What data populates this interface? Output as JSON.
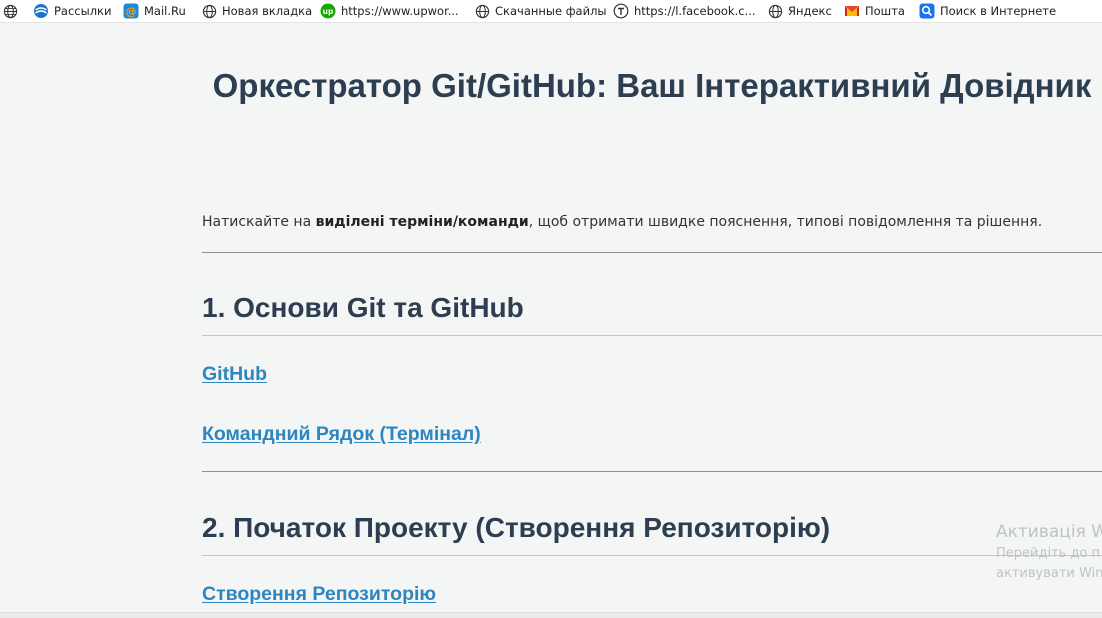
{
  "bookmarks": [
    {
      "label": "",
      "icon": "globe-icon"
    },
    {
      "label": "Рассылки",
      "icon": "mailing-icon"
    },
    {
      "label": "Mail.Ru",
      "icon": "mailru-icon"
    },
    {
      "label": "Новая вкладка",
      "icon": "globe-icon"
    },
    {
      "label": "https://www.upwor...",
      "icon": "upwork-icon"
    },
    {
      "label": "Скачанные файлы",
      "icon": "globe-icon"
    },
    {
      "label": "https://l.facebook.c...",
      "icon": "tumblr-like-icon"
    },
    {
      "label": "Яндекс",
      "icon": "globe-icon"
    },
    {
      "label": "Пошта",
      "icon": "gmail-icon"
    },
    {
      "label": "Поиск в Интернете",
      "icon": "search-icon"
    }
  ],
  "page": {
    "title": "Оркестратор Git/GitHub: Ваш Інтерактивний Довідник",
    "intro_prefix": "Натискайте на ",
    "intro_bold": "виділені терміни/команди",
    "intro_suffix": ", щоб отримати швидке пояснення, типові повідомлення та рішення."
  },
  "sections": [
    {
      "title": "1. Основи Git та GitHub",
      "terms": [
        "GitHub",
        "Командний Рядок (Термінал)"
      ]
    },
    {
      "title": "2. Початок Проекту (Створення Репозиторію)",
      "terms": [
        "Створення Репозиторію"
      ]
    }
  ],
  "watermark": {
    "title": "Активація Wi",
    "line1": "Перейдіть до п",
    "line2": "активувати Win"
  },
  "colors": {
    "heading": "#2c3e50",
    "link": "#2e86c1",
    "background": "#f4f5f5"
  }
}
